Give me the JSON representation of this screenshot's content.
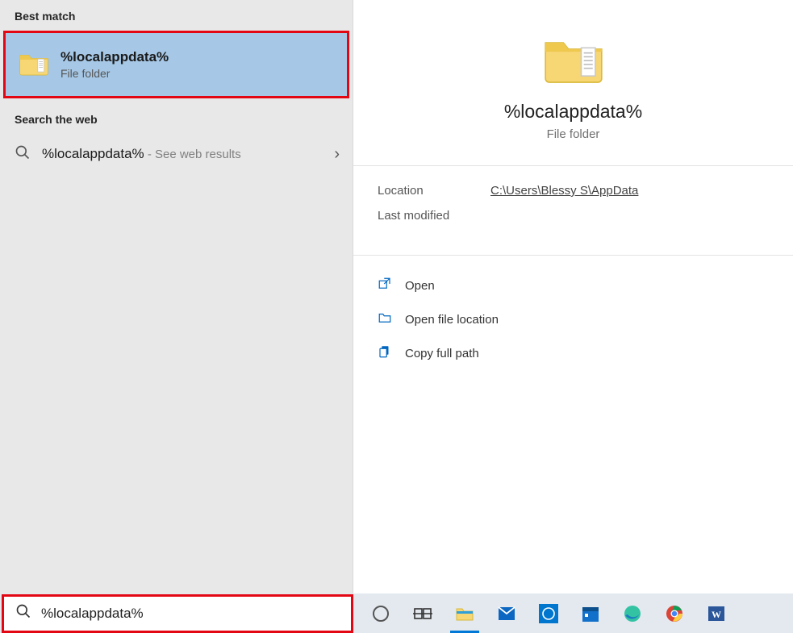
{
  "left": {
    "best_match_header": "Best match",
    "best_match": {
      "title": "%localappdata%",
      "subtitle": "File folder"
    },
    "search_web_header": "Search the web",
    "web_result": {
      "term": "%localappdata%",
      "suffix": " - See web results"
    }
  },
  "details": {
    "title": "%localappdata%",
    "subtitle": "File folder",
    "location_label": "Location",
    "location_value": "C:\\Users\\Blessy S\\AppData",
    "last_modified_label": "Last modified",
    "actions": {
      "open": "Open",
      "open_location": "Open file location",
      "copy_path": "Copy full path"
    }
  },
  "search": {
    "value": "%localappdata%"
  }
}
